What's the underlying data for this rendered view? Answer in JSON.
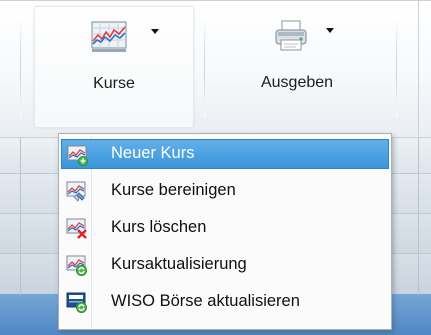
{
  "ribbon": {
    "buttons": [
      {
        "label": "Kurse",
        "icon": "chart-icon",
        "has_dropdown": true,
        "active": true
      },
      {
        "label": "Ausgeben",
        "icon": "printer-icon",
        "has_dropdown": true,
        "active": false
      }
    ]
  },
  "menu": {
    "items": [
      {
        "label": "Neuer Kurs",
        "icon": "chart-new-icon",
        "highlighted": true
      },
      {
        "label": "Kurse bereinigen",
        "icon": "chart-clean-icon",
        "highlighted": false
      },
      {
        "label": "Kurs löschen",
        "icon": "chart-delete-icon",
        "highlighted": false
      },
      {
        "label": "Kursaktualisierung",
        "icon": "chart-update-icon",
        "highlighted": false
      },
      {
        "label": "WISO Börse aktualisieren",
        "icon": "wiso-update-icon",
        "highlighted": false
      }
    ]
  },
  "colors": {
    "highlight": "#3a95d9",
    "selection_bar": "#4f88c5"
  }
}
